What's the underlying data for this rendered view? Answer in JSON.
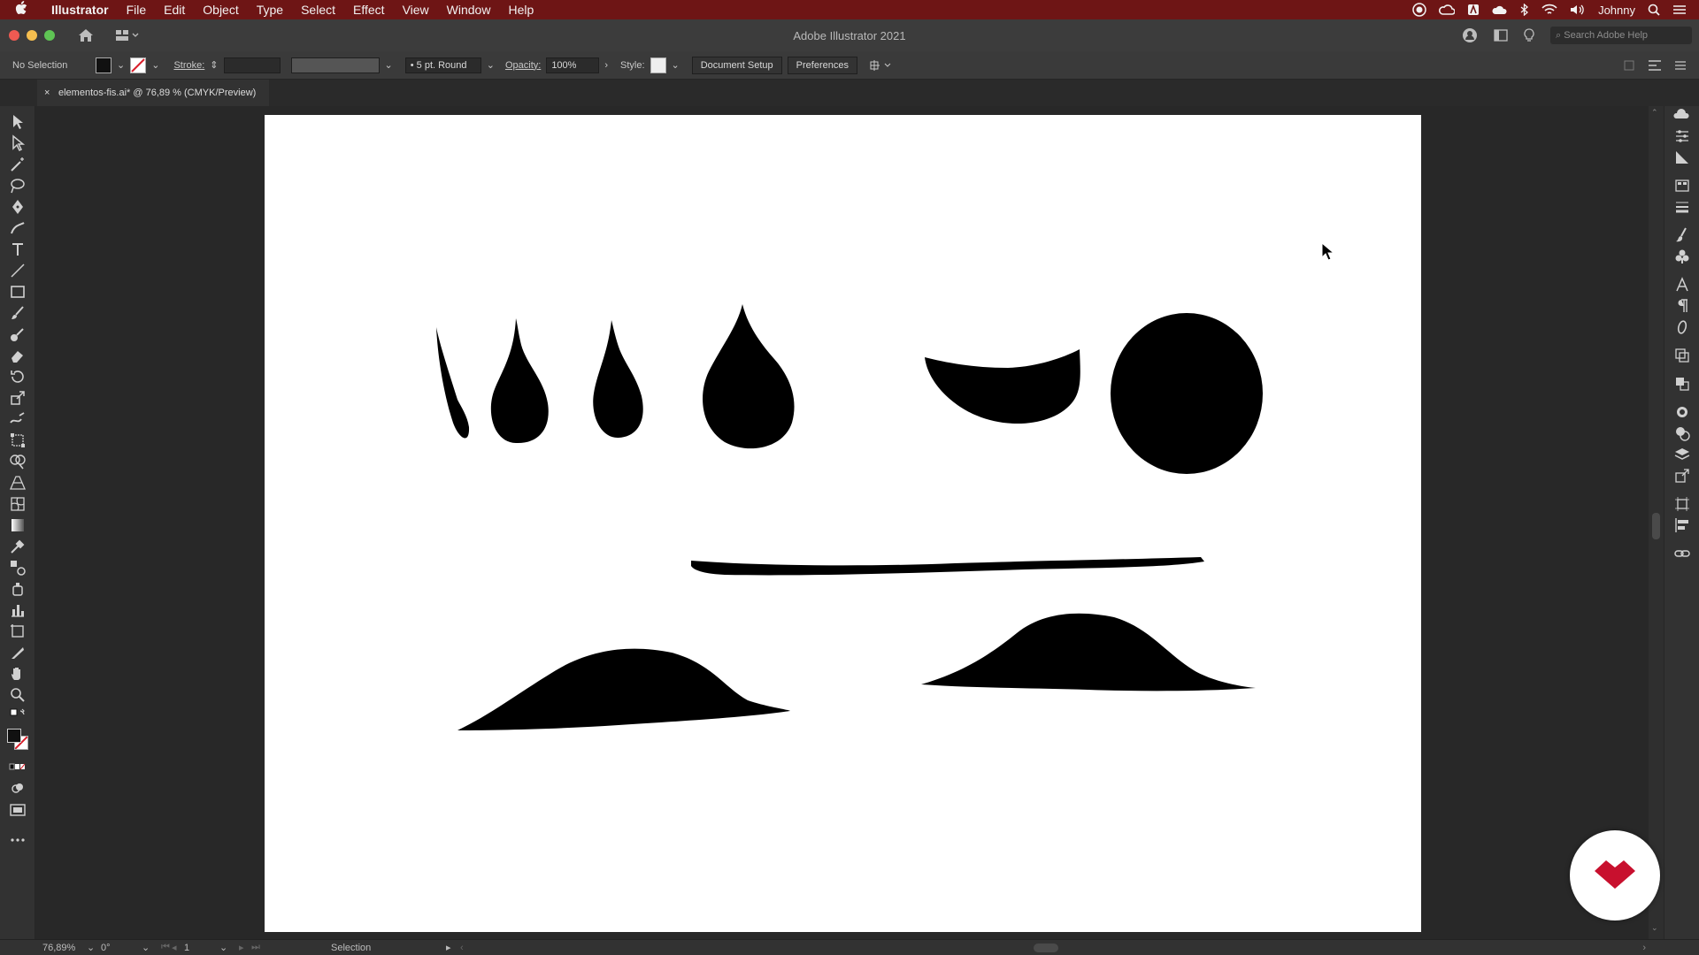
{
  "menubar": {
    "apple": "",
    "app_name": "Illustrator",
    "items": [
      "File",
      "Edit",
      "Object",
      "Type",
      "Select",
      "Effect",
      "View",
      "Window",
      "Help"
    ],
    "user": "Johnny"
  },
  "titlebar": {
    "title": "Adobe Illustrator 2021",
    "search_placeholder": "Search Adobe Help"
  },
  "control": {
    "selection": "No Selection",
    "stroke_label": "Stroke:",
    "brush": "5 pt. Round",
    "opacity_label": "Opacity:",
    "opacity_value": "100%",
    "style_label": "Style:",
    "document_setup": "Document Setup",
    "preferences": "Preferences"
  },
  "tab": {
    "close": "×",
    "name": "elementos-fis.ai* @ 76,89 % (CMYK/Preview)"
  },
  "status": {
    "zoom": "76,89%",
    "rotation": "0°",
    "artboard": "1",
    "tool": "Selection"
  },
  "colors": {
    "menubar": "#6e1515",
    "accent": "#c8102e"
  }
}
